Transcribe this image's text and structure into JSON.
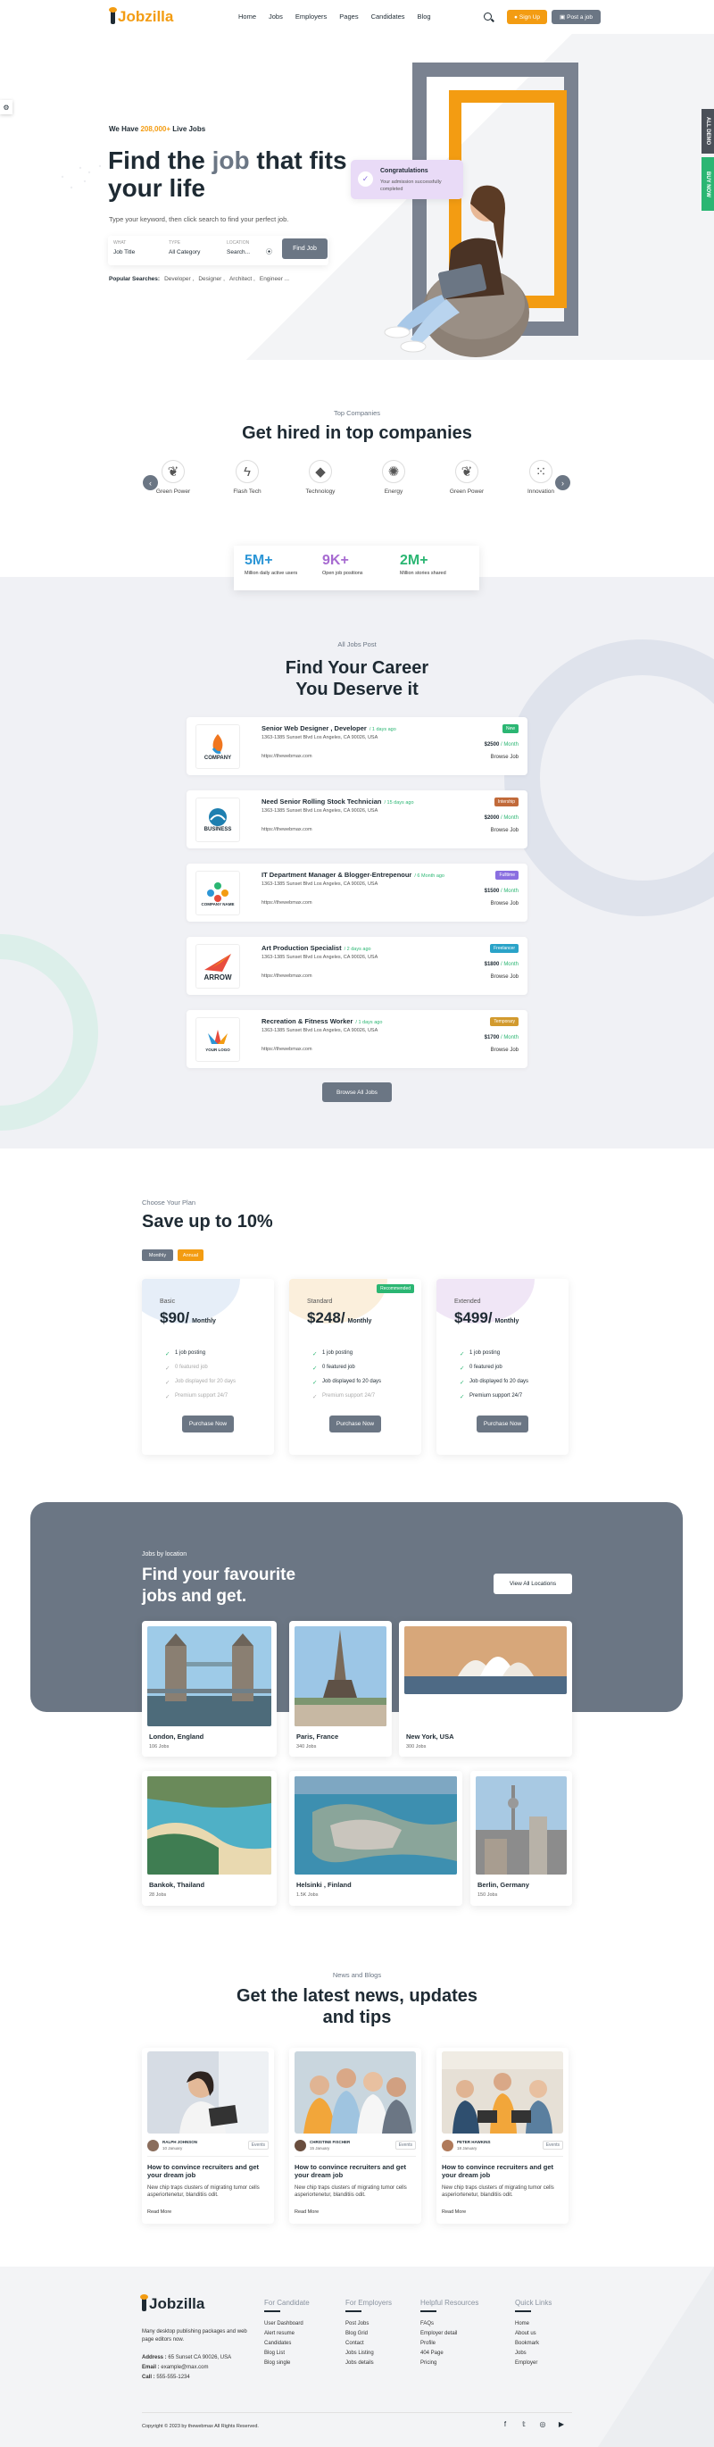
{
  "brand": {
    "name": "Jobzilla",
    "accent": "#f39c12",
    "primary": "#6b7684"
  },
  "nav": {
    "items": [
      "Home",
      "Jobs",
      "Employers",
      "Pages",
      "Candidates",
      "Blog"
    ],
    "sign_up": "Sign Up",
    "post_job": "Post a job"
  },
  "hero": {
    "sub_prefix": "We Have ",
    "count": "208,000+",
    "sub_suffix": " Live Jobs",
    "title_1": "Find the ",
    "title_hl": "job",
    "title_2": " that fits your life",
    "desc": "Type your keyword, then click search to find your perfect job.",
    "fields": [
      {
        "label": "WHAT",
        "value": "Job Title"
      },
      {
        "label": "TYPE",
        "value": "All Category"
      },
      {
        "label": "LOCATION",
        "value": "Search..."
      }
    ],
    "find_btn": "Find Job",
    "popular_label": "Popular Searches:",
    "popular": [
      "Developer ,",
      "Designer ,",
      "Architect ,",
      "Engineer ..."
    ],
    "toast_title": "Congratulations",
    "toast_text": "Your admission successfully completed"
  },
  "side_tabs": {
    "demo": "ALL DEMO",
    "buy": "BUY NOW"
  },
  "companies": {
    "tag": "Top Companies",
    "title": "Get hired in top companies",
    "items": [
      {
        "name": "Green Power",
        "icon": "leaf-icon"
      },
      {
        "name": "Flash Tech",
        "icon": "bolt-icon"
      },
      {
        "name": "Technology",
        "icon": "bolt-diamond-icon"
      },
      {
        "name": "Energy",
        "icon": "swirl-icon"
      },
      {
        "name": "Green Power",
        "icon": "leaf-icon"
      },
      {
        "name": "Innovation",
        "icon": "dots-icon"
      }
    ]
  },
  "stats": [
    {
      "value": "5M+",
      "label": "Million daily active users",
      "color": "#2d96d6"
    },
    {
      "value": "9K+",
      "label": "Open job positions",
      "color": "#a76bd1"
    },
    {
      "value": "2M+",
      "label": "Million stories shared",
      "color": "#2bb673"
    }
  ],
  "jobs": {
    "tag": "All Jobs Post",
    "title": "Find Your Career You Deserve it",
    "browse": "Browse All Jobs",
    "items": [
      {
        "title": "Senior Web Designer , Developer",
        "ago": "/ 1 days ago",
        "address": "1363-1385 Sunset Blvd Los Angeles, CA 90026, USA",
        "url": "https://thewebmax.com",
        "type": "New",
        "type_color": "#2bb673",
        "salary": "$2500",
        "per": " / Month",
        "browse": "Browse Job",
        "logo": "COMPANY"
      },
      {
        "title": "Need Senior Rolling Stock Technician",
        "ago": "/ 15 days ago",
        "address": "1363-1385 Sunset Blvd Los Angeles, CA 90026, USA",
        "url": "https://thewebmax.com",
        "type": "Intership",
        "type_color": "#c16a3a",
        "salary": "$2000",
        "per": " / Month",
        "browse": "Browse Job",
        "logo": "BUSINESS"
      },
      {
        "title": "IT Department Manager & Blogger-Entrepenour",
        "ago": "/ 6 Month ago",
        "address": "1363-1385 Sunset Blvd Los Angeles, CA 90026, USA",
        "url": "https://thewebmax.com",
        "type": "Fulltime",
        "type_color": "#8a6fe0",
        "salary": "$1500",
        "per": " / Month",
        "browse": "Browse Job",
        "logo": "COMPANY NAME"
      },
      {
        "title": "Art Production Specialist",
        "ago": "/ 2 days ago",
        "address": "1363-1385 Sunset Blvd Los Angeles, CA 90026, USA",
        "url": "https://thewebmax.com",
        "type": "Freelancer",
        "type_color": "#2aa3c8",
        "salary": "$1800",
        "per": " / Month",
        "browse": "Browse Job",
        "logo": "ARROW"
      },
      {
        "title": "Recreation & Fitness Worker",
        "ago": "/ 1 days ago",
        "address": "1363-1385 Sunset Blvd Los Angeles, CA 90026, USA",
        "url": "https://thewebmax.com",
        "type": "Temporary",
        "type_color": "#d29a2e",
        "salary": "$1700",
        "per": " / Month",
        "browse": "Browse Job",
        "logo": "YOUR LOGO"
      }
    ]
  },
  "pricing": {
    "tag": "Choose Your Plan",
    "title": "Save up to 10%",
    "toggle": [
      "Monthly",
      "Annual"
    ],
    "plans": [
      {
        "name": "Basic",
        "price": "$90/",
        "period": "Monthly",
        "features": [
          {
            "t": "1 job posting",
            "on": true
          },
          {
            "t": "0 featured job",
            "on": false
          },
          {
            "t": "Job displayed for 20 days",
            "on": false
          },
          {
            "t": "Premium support 24/7",
            "on": false
          }
        ],
        "button": "Purchase Now",
        "circle": "#e6eef8"
      },
      {
        "name": "Standard",
        "price": "$248/",
        "period": "Monthly",
        "features": [
          {
            "t": "1 job posting",
            "on": true
          },
          {
            "t": "0 featured job",
            "on": true
          },
          {
            "t": "Job displayed fo 20 days",
            "on": true
          },
          {
            "t": "Premium support 24/7",
            "on": false
          }
        ],
        "button": "Purchase Now",
        "circle": "#fbefdc",
        "badge": "Recommended"
      },
      {
        "name": "Extended",
        "price": "$499/",
        "period": "Monthly",
        "features": [
          {
            "t": "1 job posting",
            "on": true
          },
          {
            "t": "0 featured job",
            "on": true
          },
          {
            "t": "Job displayed fo 20 days",
            "on": true
          },
          {
            "t": "Premium support 24/7",
            "on": true
          }
        ],
        "button": "Purchase Now",
        "circle": "#f0e6f6"
      }
    ]
  },
  "locations": {
    "tag": "Jobs by location",
    "title": "Find your favourite jobs and get.",
    "view_all": "View All Locations",
    "items": [
      {
        "city": "London, England",
        "jobs": "106 Jobs"
      },
      {
        "city": "Paris, France",
        "jobs": "340 Jobs"
      },
      {
        "city": "New York, USA",
        "jobs": "300 Jobs"
      },
      {
        "city": "Bankok, Thailand",
        "jobs": "28 Jobs"
      },
      {
        "city": "Helsinki , Finland",
        "jobs": "1.5K Jobs"
      },
      {
        "city": "Berlin, Germany",
        "jobs": "150 Jobs"
      }
    ]
  },
  "blog": {
    "tag": "News and Blogs",
    "title": "Get the latest news, updates and tips",
    "posts": [
      {
        "author": "RALPH JOHNSON",
        "date": "10 January",
        "tag": "Events",
        "title": "How to convince recruiters and get your dream job",
        "text": "New chip traps clusters of migrating tumor cells asperiortenetur, blanditiis odit.",
        "more": "Read More"
      },
      {
        "author": "CHRISTINE FISCHER",
        "date": "15 January",
        "tag": "Events",
        "title": "How to convince recruiters and get your dream job",
        "text": "New chip traps clusters of migrating tumor cells asperiortenetur, blanditiis odit.",
        "more": "Read More"
      },
      {
        "author": "PETER HAWKINS",
        "date": "18 January",
        "tag": "Events",
        "title": "How to convince recruiters and get your dream job",
        "text": "New chip traps clusters of migrating tumor cells asperiortenetur, blanditiis odit.",
        "more": "Read More"
      }
    ]
  },
  "footer": {
    "about": "Many desktop publishing packages and web page editors now.",
    "address_label": "Address :",
    "address": "65 Sunset CA 90026, USA",
    "email_label": "Email :",
    "email": "example@max.com",
    "call_label": "Call :",
    "call": "555-555-1234",
    "cols": [
      {
        "title": "For Candidate",
        "links": [
          "User Dashboard",
          "Alert resume",
          "Candidates",
          "Blog List",
          "Blog single"
        ]
      },
      {
        "title": "For Employers",
        "links": [
          "Post Jobs",
          "Blog Grid",
          "Contact",
          "Jobs Listing",
          "Jobs details"
        ]
      },
      {
        "title": "Helpful Resources",
        "links": [
          "FAQs",
          "Employer detail",
          "Profile",
          "404 Page",
          "Pricing"
        ]
      },
      {
        "title": "Quick Links",
        "links": [
          "Home",
          "About us",
          "Bookmark",
          "Jobs",
          "Employer"
        ]
      }
    ],
    "copyright": "Copyright © 2023 by thewebmax All Rights Reserved."
  }
}
